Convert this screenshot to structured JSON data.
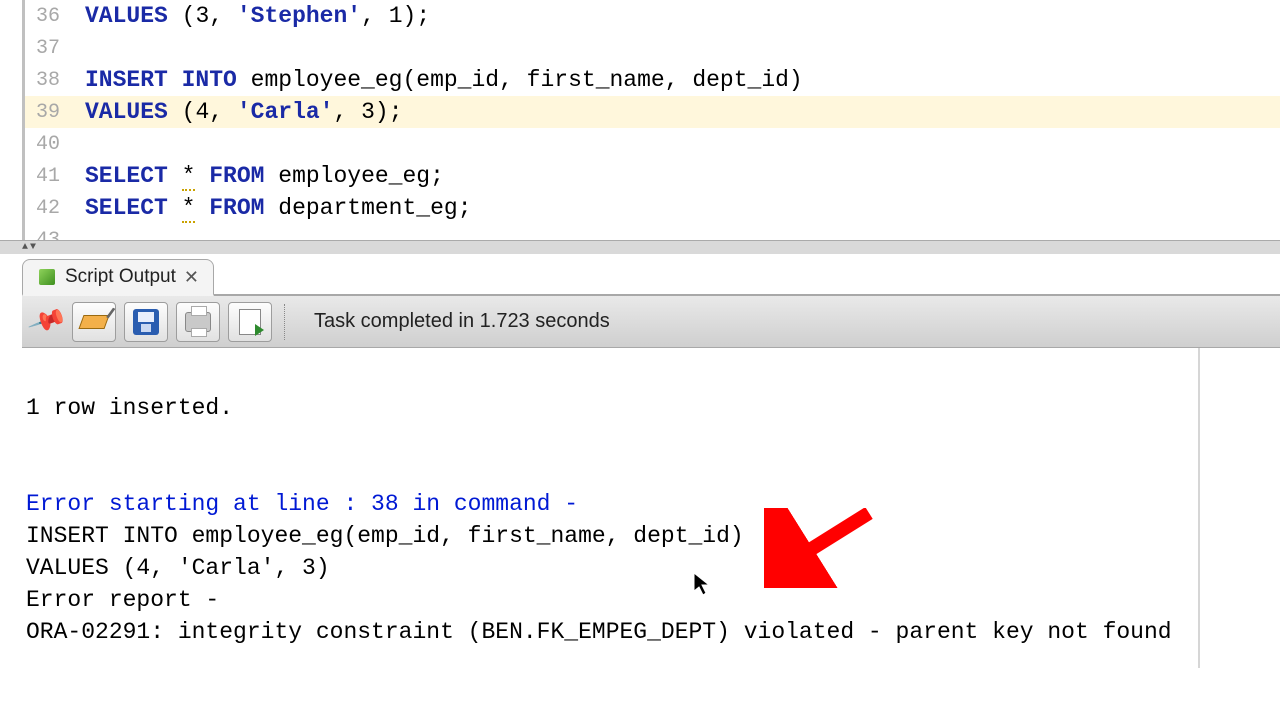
{
  "editor": {
    "lines": [
      {
        "num": 36,
        "tokens": [
          {
            "cls": "kw",
            "t": "VALUES "
          },
          {
            "cls": "pn",
            "t": "("
          },
          {
            "cls": "pn",
            "t": "3"
          },
          {
            "cls": "pn",
            "t": ", "
          },
          {
            "cls": "str",
            "t": "'Stephen'"
          },
          {
            "cls": "pn",
            "t": ", "
          },
          {
            "cls": "pn",
            "t": "1"
          },
          {
            "cls": "pn",
            "t": ");"
          }
        ],
        "hl": false
      },
      {
        "num": 37,
        "tokens": [],
        "hl": false
      },
      {
        "num": 38,
        "tokens": [
          {
            "cls": "kw",
            "t": "INSERT INTO "
          },
          {
            "cls": "pn",
            "t": "employee_eg(emp_id, first_name, dept_id)"
          }
        ],
        "hl": false
      },
      {
        "num": 39,
        "tokens": [
          {
            "cls": "kw",
            "t": "VALUES "
          },
          {
            "cls": "pn",
            "t": "("
          },
          {
            "cls": "pn",
            "t": "4"
          },
          {
            "cls": "pn",
            "t": ", "
          },
          {
            "cls": "str",
            "t": "'Carla'"
          },
          {
            "cls": "pn",
            "t": ", "
          },
          {
            "cls": "pn",
            "t": "3"
          },
          {
            "cls": "pn",
            "t": ");"
          }
        ],
        "hl": true
      },
      {
        "num": 40,
        "tokens": [],
        "hl": false
      },
      {
        "num": 41,
        "tokens": [
          {
            "cls": "kw",
            "t": "SELECT "
          },
          {
            "cls": "star",
            "t": "*"
          },
          {
            "cls": "kw",
            "t": " FROM "
          },
          {
            "cls": "pn",
            "t": "employee_eg;"
          }
        ],
        "hl": false
      },
      {
        "num": 42,
        "tokens": [
          {
            "cls": "kw",
            "t": "SELECT "
          },
          {
            "cls": "star",
            "t": "*"
          },
          {
            "cls": "kw",
            "t": " FROM "
          },
          {
            "cls": "pn",
            "t": "department_eg;"
          }
        ],
        "hl": false
      },
      {
        "num": 43,
        "tokens": [],
        "hl": false
      }
    ]
  },
  "tab": {
    "label": "Script Output"
  },
  "toolbar": {
    "status": "Task completed in 1.723 seconds"
  },
  "output": {
    "row_inserted": "1 row inserted.",
    "err_header": "Error starting at line : 38 in command -",
    "err_sql1": "INSERT INTO employee_eg(emp_id, first_name, dept_id)",
    "err_sql2": "VALUES (4, 'Carla', 3)",
    "err_report": "Error report -",
    "err_ora": "ORA-02291: integrity constraint (BEN.FK_EMPEG_DEPT) violated - parent key not found"
  }
}
